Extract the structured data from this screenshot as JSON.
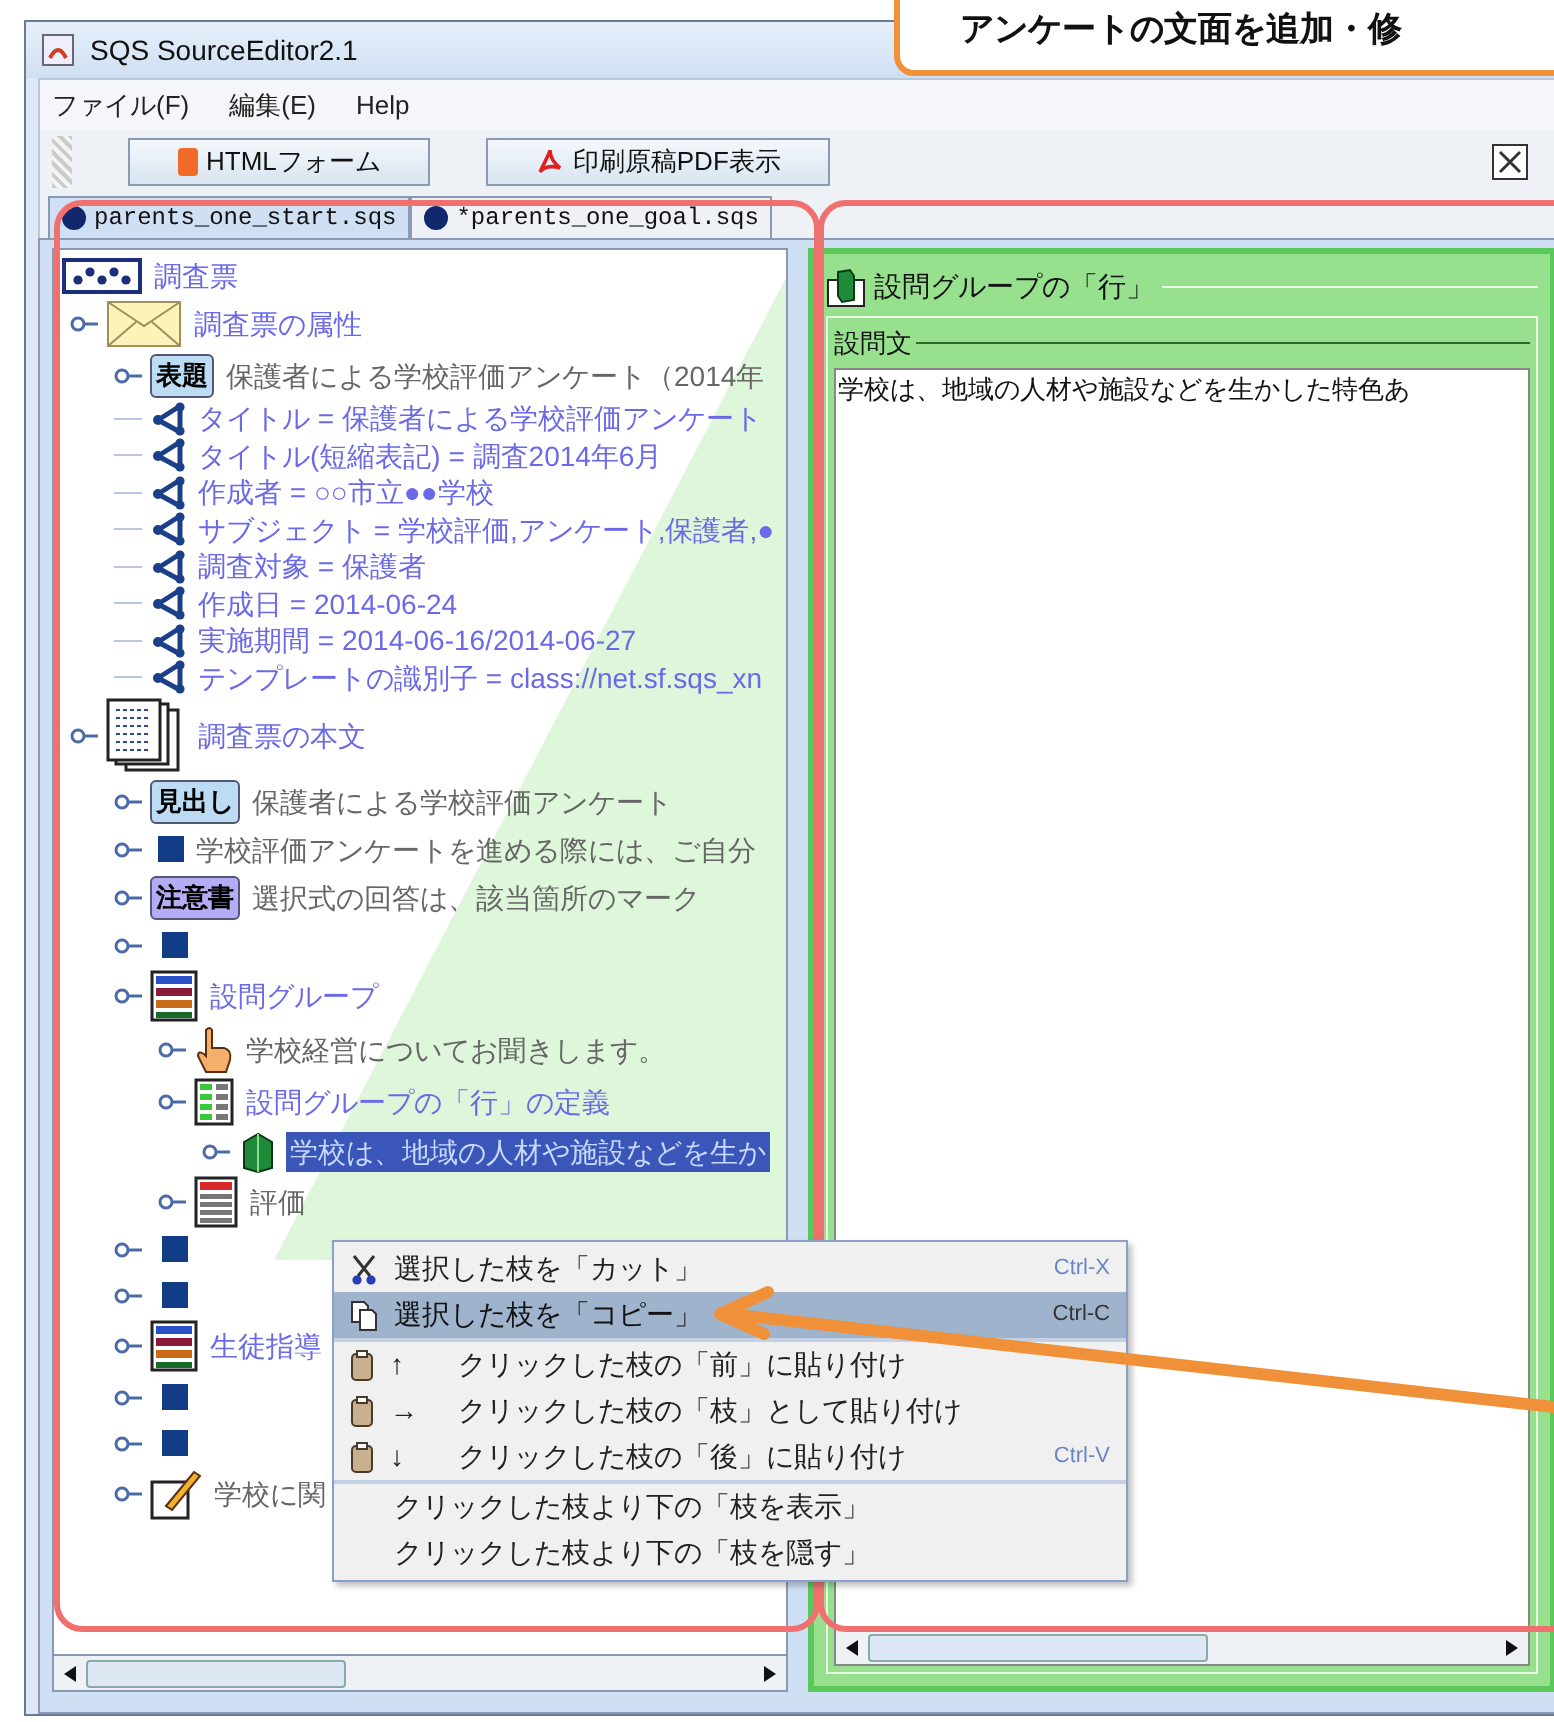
{
  "callout": {
    "text": "アンケートの文面を追加・修"
  },
  "window": {
    "title": "SQS SourceEditor2.1"
  },
  "menu_bar": [
    "ファイル(F)",
    "編集(E)",
    "Help"
  ],
  "toolbar": {
    "buttons": [
      {
        "kind": "html",
        "label": "HTMLフォーム"
      },
      {
        "kind": "pdf",
        "label": "印刷原稿PDF表示"
      }
    ]
  },
  "tabs": [
    {
      "label": "parents_one_start.sqs",
      "selected": true
    },
    {
      "label": "*parents_one_goal.sqs",
      "selected": false
    }
  ],
  "tree": {
    "kind": "root",
    "label": "調査票",
    "selected": false,
    "children": [
      {
        "kind": "attributes",
        "label": "調査票の属性",
        "selected": false,
        "children": [
          {
            "kind": "tag",
            "tag": "表題",
            "color": "#bcdcf4",
            "label": "保護者による学校評価アンケート（2014年",
            "selected": false
          },
          {
            "kind": "property",
            "label": "タイトル = 保護者による学校評価アンケート",
            "selected": false
          },
          {
            "kind": "property",
            "label": "タイトル(短縮表記) = 調査2014年6月",
            "selected": false
          },
          {
            "kind": "property",
            "label": "作成者 = ○○市立●●学校",
            "selected": false
          },
          {
            "kind": "property",
            "label": "サブジェクト = 学校評価,アンケート,保護者,●",
            "selected": false
          },
          {
            "kind": "property",
            "label": "調査対象 = 保護者",
            "selected": false
          },
          {
            "kind": "property",
            "label": "作成日 = 2014-06-24",
            "selected": false
          },
          {
            "kind": "property",
            "label": "実施期間 = 2014-06-16/2014-06-27",
            "selected": false
          },
          {
            "kind": "property",
            "label": "テンプレートの識別子 = class://net.sf.sqs_xn",
            "selected": false
          }
        ]
      },
      {
        "kind": "body",
        "label": "調査票の本文",
        "selected": false,
        "children": [
          {
            "kind": "tag",
            "tag": "見出し",
            "color": "#bcdcf4",
            "label": "保護者による学校評価アンケート",
            "selected": false
          },
          {
            "kind": "block",
            "label": "学校評価アンケートを進める際には、ご自分",
            "selected": false
          },
          {
            "kind": "tag",
            "tag": "注意書",
            "color": "#b4acf4",
            "label": "選択式の回答は、該当箇所のマーク",
            "selected": false
          },
          {
            "kind": "block",
            "selected": false
          },
          {
            "kind": "group",
            "label": "設問グループ",
            "selected": false,
            "children": [
              {
                "kind": "hand",
                "label": "学校経営についてお聞きします。",
                "selected": false
              },
              {
                "kind": "row_def",
                "label": "設問グループの「行」の定義",
                "selected": false,
                "children": [
                  {
                    "kind": "row",
                    "label": "学校は、地域の人材や施設などを生か",
                    "selected": true
                  }
                ]
              },
              {
                "kind": "eval",
                "label": "評価",
                "selected": false
              }
            ]
          },
          {
            "kind": "block",
            "selected": false
          },
          {
            "kind": "block",
            "selected": false
          },
          {
            "kind": "group",
            "label": "生徒指導",
            "selected": false
          },
          {
            "kind": "block",
            "selected": false
          },
          {
            "kind": "block",
            "selected": false
          },
          {
            "kind": "freeform",
            "label": "学校に関",
            "selected": false
          }
        ]
      }
    ]
  },
  "context_menu": {
    "groups": [
      [
        {
          "kind": "cut",
          "label": "選択した枝を「カット」",
          "shortcut": "Ctrl-X",
          "selected": false
        },
        {
          "kind": "copy",
          "label": "選択した枝を「コピー」",
          "shortcut": "Ctrl-C",
          "selected": true
        }
      ],
      [
        {
          "kind": "paste",
          "arrow": "↑",
          "label": "クリックした枝の「前」に貼り付け",
          "selected": false
        },
        {
          "kind": "paste",
          "arrow": "→",
          "label": "クリックした枝の「枝」として貼り付け",
          "selected": false
        },
        {
          "kind": "paste",
          "arrow": "↓",
          "label": "クリックした枝の「後」に貼り付け",
          "shortcut": "Ctrl-V",
          "selected": false
        }
      ],
      [
        {
          "kind": "plain",
          "label": "クリックした枝より下の「枝を表示」",
          "selected": false
        },
        {
          "kind": "plain",
          "label": "クリックした枝より下の「枝を隠す」",
          "selected": false
        }
      ]
    ]
  },
  "detail": {
    "title": "設問グループの「行」",
    "field_label": "設問文",
    "value": "学校は、地域の人材や施設などを生かした特色あ"
  }
}
